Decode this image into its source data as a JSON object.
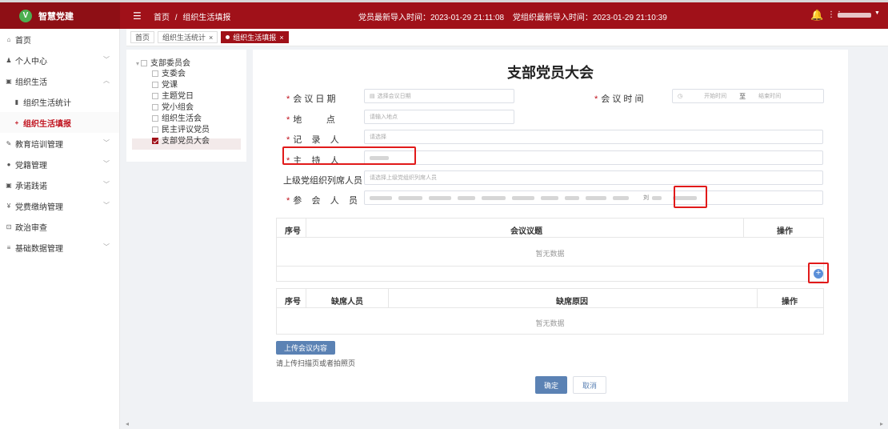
{
  "header": {
    "app_name": "智慧党建",
    "logo_letter": "V",
    "menu_icon": "hamburger-icon",
    "breadcrumb": [
      "首页",
      "/",
      "组织生活填报"
    ],
    "import_member": "党员最新导入时间：2023-01-29 21:11:08",
    "import_org": "党组织最新导入时间：2023-01-29 21:10:39",
    "bell_icon": "🔔",
    "grid_icon": "⋮⋮",
    "user_caret": "▼",
    "colors": {
      "bar": "#a01119",
      "logo_bg": "#8e0f15",
      "logo_circle": "#4caf50"
    }
  },
  "sidebar": {
    "items": [
      {
        "label": "首页",
        "icon": "⌂",
        "has_chevron": false
      },
      {
        "label": "个人中心",
        "icon": "♟",
        "has_chevron": true
      },
      {
        "label": "组织生活",
        "icon": "▣",
        "has_chevron": true,
        "expanded": true
      },
      {
        "label": "组织生活统计",
        "icon": "▮",
        "sub": true
      },
      {
        "label": "组织生活填报",
        "icon": "+",
        "sub": true,
        "active": true
      },
      {
        "label": "教育培训管理",
        "icon": "✎",
        "has_chevron": true
      },
      {
        "label": "党籍管理",
        "icon": "●",
        "has_chevron": true
      },
      {
        "label": "承诺践诺",
        "icon": "▣",
        "has_chevron": true
      },
      {
        "label": "党费缴纳管理",
        "icon": "¥",
        "has_chevron": true
      },
      {
        "label": "政治审查",
        "icon": "⊡",
        "has_chevron": false
      },
      {
        "label": "基础数据管理",
        "icon": "≡",
        "has_chevron": true
      }
    ],
    "chevron_down": "﹀",
    "chevron_up": "︿"
  },
  "tabs": [
    {
      "label": "首页",
      "closable": false
    },
    {
      "label": "组织生活统计",
      "closable": true
    },
    {
      "label": "组织生活填报",
      "closable": true,
      "active": true
    }
  ],
  "tab_close": "×",
  "tree": {
    "root": "支部委员会",
    "children": [
      {
        "label": "支委会",
        "checked": false
      },
      {
        "label": "党课",
        "checked": false
      },
      {
        "label": "主题党日",
        "checked": false
      },
      {
        "label": "党小组会",
        "checked": false
      },
      {
        "label": "组织生活会",
        "checked": false
      },
      {
        "label": "民主评议党员",
        "checked": false
      },
      {
        "label": "支部党员大会",
        "checked": true
      }
    ],
    "expander": "▾"
  },
  "form": {
    "title": "支部党员大会",
    "required_mark": "*",
    "date_label": "会 议 日 期",
    "date_placeholder": "选择会议日期",
    "date_icon": "▤",
    "time_label": "会 议 时 间",
    "time_icon": "◷",
    "time_start_placeholder": "开始时间",
    "time_sep": "至",
    "time_end_placeholder": "结束时间",
    "place_label": "地          点",
    "place_placeholder": "请输入地点",
    "recorder_label": "记    录    人",
    "recorder_placeholder": "请选择",
    "host_label": "主    持    人",
    "superior_label": "上级党组织列席人员",
    "superior_placeholder": "请选择上级党组织列席人员",
    "attendee_label": "参    会    人    员",
    "attendee_visible_char": "刘"
  },
  "topic_table": {
    "headers": [
      "序号",
      "会议议题",
      "操作"
    ],
    "empty_text": "暂无数据",
    "add_icon": "+"
  },
  "absence_table": {
    "headers": [
      "序号",
      "缺席人员",
      "缺席原因",
      "操作"
    ],
    "empty_text": "暂无数据"
  },
  "upload": {
    "button_label": "上传会议内容",
    "hint": "请上传扫描页或者拍照页"
  },
  "actions": {
    "ok_label": "确定",
    "cancel_label": "取消"
  },
  "scroll": {
    "left": "◂",
    "right": "▸"
  }
}
